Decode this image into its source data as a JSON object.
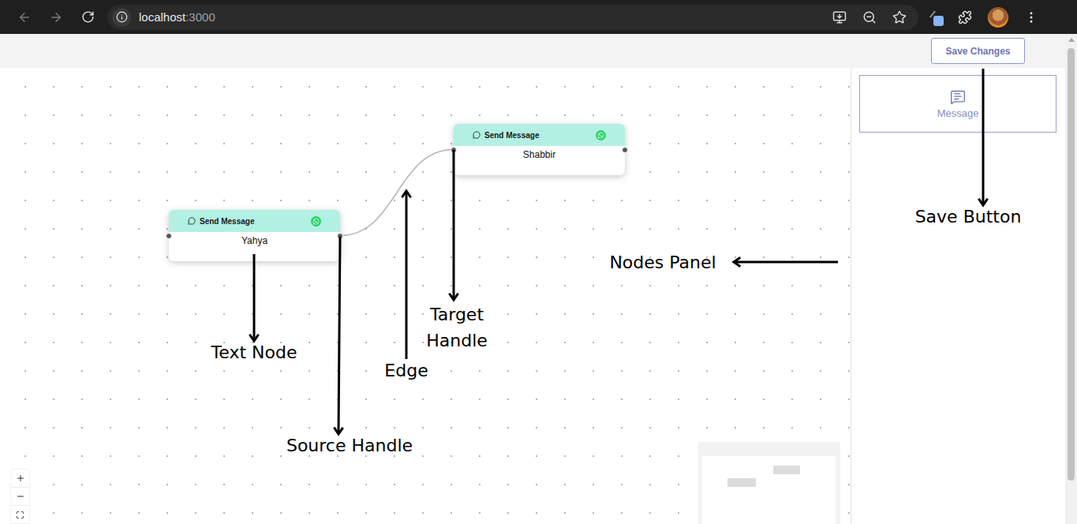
{
  "browser": {
    "url": {
      "host": "localhost",
      "port": ":3000"
    }
  },
  "toolbar": {
    "save_button": "Save Changes"
  },
  "nodes_panel": {
    "items": [
      {
        "label": "Message"
      }
    ]
  },
  "nodes": [
    {
      "title": "Send Message",
      "text": "Yahya"
    },
    {
      "title": "Send Message",
      "text": "Shabbir"
    }
  ],
  "edges": [
    {
      "from": 0,
      "to": 1
    }
  ],
  "annotations": [
    {
      "label": "Save Button"
    },
    {
      "label": "Nodes Panel"
    },
    {
      "label": "Text Node"
    },
    {
      "label": "Source Handle"
    },
    {
      "label": "Edge"
    },
    {
      "label": "Target Handle"
    }
  ]
}
